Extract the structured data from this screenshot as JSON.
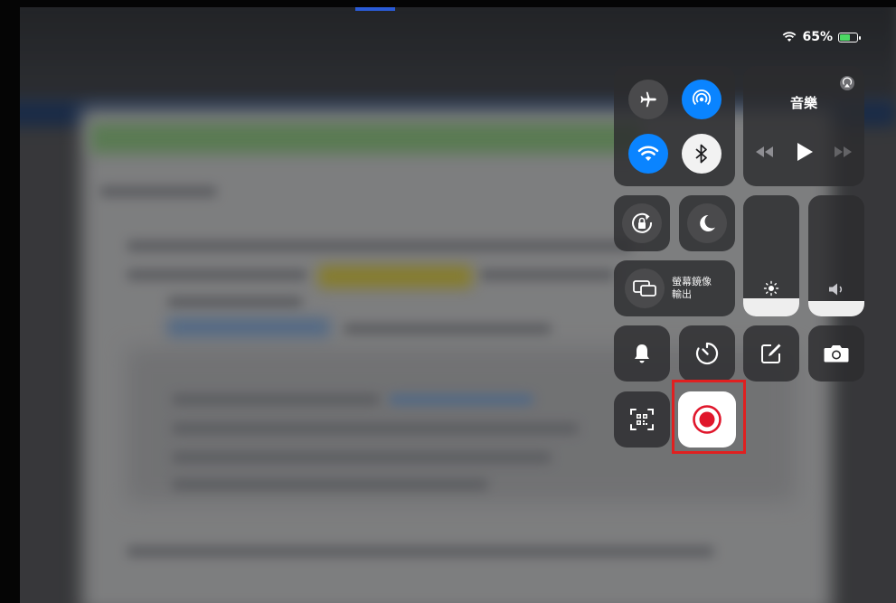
{
  "status_bar": {
    "battery_text": "65%",
    "battery_level": 0.65
  },
  "music": {
    "title": "音樂"
  },
  "screen_mirroring": {
    "label_line1": "螢幕鏡像",
    "label_line2": "輸出"
  },
  "sliders": {
    "brightness_level": 0.15,
    "volume_level": 0.13
  },
  "colors": {
    "accent_blue": "#0a84ff",
    "record_red": "#e0162b",
    "highlight_frame": "#e02020"
  },
  "icons": [
    "airplane-icon",
    "airdrop-icon",
    "wifi-icon",
    "bluetooth-icon",
    "airplay-icon",
    "rewind-icon",
    "play-icon",
    "fast-forward-icon",
    "rotation-lock-icon",
    "moon-icon",
    "screen-mirroring-icon",
    "brightness-icon",
    "volume-icon",
    "bell-icon",
    "timer-icon",
    "notes-icon",
    "camera-icon",
    "qr-scanner-icon",
    "screen-record-icon"
  ]
}
